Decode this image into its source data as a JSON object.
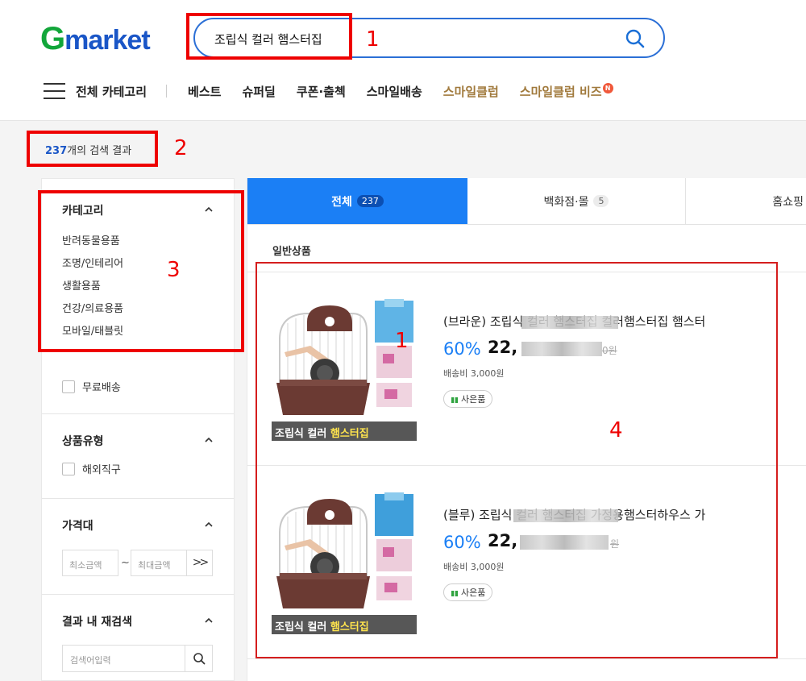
{
  "header": {
    "logo_g": "G",
    "logo_rest": "market",
    "search_value": "조립식 컬러 햄스터집",
    "search_icon": "search-icon"
  },
  "nav": {
    "all_category": "전체 카테고리",
    "items": [
      "베스트",
      "슈퍼딜",
      "쿠폰·출첵",
      "스마일배송"
    ],
    "gold_items": [
      "스마일클럽",
      "스마일클럽 비즈"
    ],
    "new_badge": "N",
    "gold_color": "#a17a3d"
  },
  "result": {
    "count": "237",
    "label": "개의 검색 결과"
  },
  "sidebar": {
    "category_title": "카테고리",
    "categories": [
      "반려동물용품",
      "조명/인테리어",
      "생활용품",
      "건강/의료용품",
      "모바일/태블릿"
    ],
    "free_shipping": "무료배송",
    "product_type_title": "상품유형",
    "overseas": "해외직구",
    "price_title": "가격대",
    "price_min_placeholder": "최소금액",
    "price_max_placeholder": "최대금액",
    "price_tilde": "~",
    "price_go": ">>",
    "research_title": "결과 내 재검색",
    "research_placeholder": "검색어입력"
  },
  "tabs": [
    {
      "label": "전체",
      "count": "237"
    },
    {
      "label": "백화점·몰",
      "count": "5"
    },
    {
      "label": "홈쇼핑",
      "count": ""
    }
  ],
  "main": {
    "general_label": "일반상품"
  },
  "products": [
    {
      "title": "(브라운) 조립식 컬러 햄스터집 컬러햄스터집 햄스터",
      "discount": "60%",
      "price": "22,",
      "orig_suffix": "0원",
      "shipping": "배송비 3,000원",
      "gift": "사은품",
      "thumb_caption_a": "조립식 컬러 ",
      "thumb_caption_b": "햄스터집",
      "cage_color": "#6b3a33"
    },
    {
      "title": "(블루) 조립식 컬러 햄스터집 가정용햄스터하우스 가",
      "discount": "60%",
      "price": "22,",
      "orig_suffix": "원",
      "shipping": "배송비 3,000원",
      "gift": "사은품",
      "thumb_caption_a": "조립식 컬러 ",
      "thumb_caption_b": "햄스터집",
      "cage_color": "#6b3a33"
    }
  ],
  "annotations": [
    "1",
    "2",
    "3",
    "4",
    "1"
  ],
  "colors": {
    "brand_blue": "#1a56c7",
    "brand_green": "#12a63a",
    "tab_active": "#1b7ff5",
    "annotation_red": "#ee0000"
  }
}
